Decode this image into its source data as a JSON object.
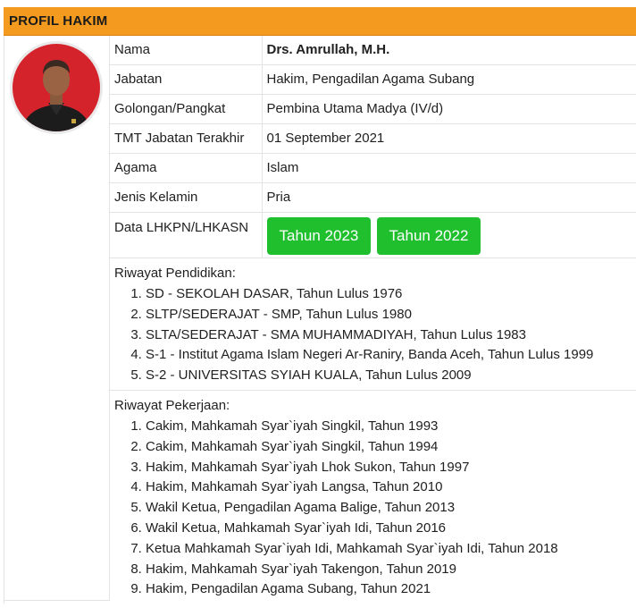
{
  "header": {
    "title": "PROFIL HAKIM"
  },
  "profile": {
    "rows": [
      {
        "label": "Nama",
        "value": "Drs. Amrullah, M.H."
      },
      {
        "label": "Jabatan",
        "value": "Hakim, Pengadilan Agama Subang"
      },
      {
        "label": "Golongan/Pangkat",
        "value": "Pembina Utama Madya (IV/d)"
      },
      {
        "label": "TMT Jabatan Terakhir",
        "value": "01 September 2021"
      },
      {
        "label": "Agama",
        "value": "Islam"
      },
      {
        "label": "Jenis Kelamin",
        "value": "Pria"
      }
    ],
    "lhkpn": {
      "label": "Data LHKPN/LHKASN",
      "buttons": [
        "Tahun 2023",
        "Tahun 2022"
      ]
    }
  },
  "education": {
    "title": "Riwayat Pendidikan:",
    "items": [
      "SD - SEKOLAH DASAR, Tahun Lulus 1976",
      "SLTP/SEDERAJAT - SMP, Tahun Lulus 1980",
      "SLTA/SEDERAJAT - SMA MUHAMMADIYAH, Tahun Lulus 1983",
      "S-1 - Institut Agama Islam Negeri Ar-Raniry, Banda Aceh, Tahun Lulus 1999",
      "S-2 - UNIVERSITAS SYIAH KUALA, Tahun Lulus 2009"
    ]
  },
  "work": {
    "title": "Riwayat Pekerjaan:",
    "items": [
      "Cakim, Mahkamah Syar`iyah Singkil, Tahun 1993",
      "Cakim, Mahkamah Syar`iyah Singkil, Tahun 1994",
      "Hakim, Mahkamah Syar`iyah Lhok Sukon, Tahun 1997",
      "Hakim, Mahkamah Syar`iyah Langsa, Tahun 2010",
      "Wakil Ketua, Pengadilan Agama Balige, Tahun 2013",
      "Wakil Ketua, Mahkamah Syar`iyah Idi, Tahun 2016",
      "Ketua Mahkamah Syar`iyah Idi, Mahkamah Syar`iyah Idi, Tahun 2018",
      "Hakim, Mahkamah Syar`iyah Takengon, Tahun 2019",
      "Hakim, Pengadilan Agama Subang, Tahun 2021"
    ]
  },
  "colors": {
    "header": "#f39a1f",
    "button": "#1fbf2e",
    "photo_bg": "#d5232c"
  }
}
